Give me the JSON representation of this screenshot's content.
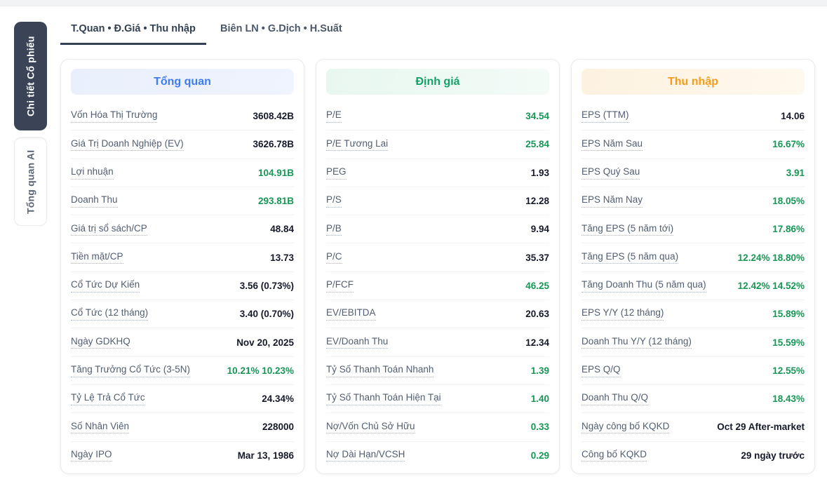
{
  "colors": {
    "side_tab_active_bg": "#3b4456",
    "tab_active": "#334155",
    "value_dark": "#15192a",
    "value_green": "#179656",
    "header_blue": "#3d7bf7",
    "header_green": "#12a266",
    "header_orange": "#f89b1b"
  },
  "side_tabs": [
    {
      "label": "Chi tiết Cổ phiếu",
      "active": true
    },
    {
      "label": "Tổng quan AI",
      "active": false
    }
  ],
  "top_tabs": [
    {
      "label": "T.Quan • Đ.Giá • Thu nhập",
      "active": true
    },
    {
      "label": "Biên LN • G.Dịch • H.Suất",
      "active": false
    }
  ],
  "cards": [
    {
      "slug": "overview",
      "theme": "blue",
      "title": "Tổng quan",
      "rows": [
        {
          "label": "Vốn Hóa Thị Trường",
          "value": "3608.42B",
          "color": "dark"
        },
        {
          "label": "Giá Trị Doanh Nghiệp (EV)",
          "value": "3626.78B",
          "color": "dark"
        },
        {
          "label": "Lợi nhuận",
          "value": "104.91B",
          "color": "green"
        },
        {
          "label": "Doanh Thu",
          "value": "293.81B",
          "color": "green"
        },
        {
          "label": "Giá trị sổ sách/CP",
          "value": "48.84",
          "color": "dark"
        },
        {
          "label": "Tiền mặt/CP",
          "value": "13.73",
          "color": "dark"
        },
        {
          "label": "Cổ Tức Dự Kiến",
          "value": "3.56 (0.73%)",
          "color": "dark"
        },
        {
          "label": "Cổ Tức (12 tháng)",
          "value": "3.40 (0.70%)",
          "color": "dark"
        },
        {
          "label": "Ngày GDKHQ",
          "value": "Nov 20, 2025",
          "color": "dark"
        },
        {
          "label": "Tăng Trưởng Cổ Tức (3-5N)",
          "value": "10.21% 10.23%",
          "color": "green"
        },
        {
          "label": "Tỷ Lệ Trả Cổ Tức",
          "value": "24.34%",
          "color": "dark"
        },
        {
          "label": "Số Nhân Viên",
          "value": "228000",
          "color": "dark"
        },
        {
          "label": "Ngày IPO",
          "value": "Mar 13, 1986",
          "color": "dark"
        }
      ]
    },
    {
      "slug": "valuation",
      "theme": "green",
      "title": "Định giá",
      "rows": [
        {
          "label": "P/E",
          "value": "34.54",
          "color": "green"
        },
        {
          "label": "P/E Tương Lai",
          "value": "25.84",
          "color": "green"
        },
        {
          "label": "PEG",
          "value": "1.93",
          "color": "dark"
        },
        {
          "label": "P/S",
          "value": "12.28",
          "color": "dark"
        },
        {
          "label": "P/B",
          "value": "9.94",
          "color": "dark"
        },
        {
          "label": "P/C",
          "value": "35.37",
          "color": "dark"
        },
        {
          "label": "P/FCF",
          "value": "46.25",
          "color": "green"
        },
        {
          "label": "EV/EBITDA",
          "value": "20.63",
          "color": "dark"
        },
        {
          "label": "EV/Doanh Thu",
          "value": "12.34",
          "color": "dark"
        },
        {
          "label": "Tỷ Số Thanh Toán Nhanh",
          "value": "1.39",
          "color": "green"
        },
        {
          "label": "Tỷ Số Thanh Toán Hiện Tại",
          "value": "1.40",
          "color": "green"
        },
        {
          "label": "Nợ/Vốn Chủ Sở Hữu",
          "value": "0.33",
          "color": "green"
        },
        {
          "label": "Nợ Dài Hạn/VCSH",
          "value": "0.29",
          "color": "green"
        }
      ]
    },
    {
      "slug": "income",
      "theme": "orange",
      "title": "Thu nhập",
      "rows": [
        {
          "label": "EPS (TTM)",
          "value": "14.06",
          "color": "dark"
        },
        {
          "label": "EPS Năm Sau",
          "value": "16.67%",
          "color": "green"
        },
        {
          "label": "EPS Quý Sau",
          "value": "3.91",
          "color": "green"
        },
        {
          "label": "EPS Năm Nay",
          "value": "18.05%",
          "color": "green"
        },
        {
          "label": "Tăng EPS (5 năm tới)",
          "value": "17.86%",
          "color": "green"
        },
        {
          "label": "Tăng EPS (5 năm qua)",
          "value": "12.24% 18.80%",
          "color": "green"
        },
        {
          "label": "Tăng Doanh Thu (5 năm qua)",
          "value": "12.42% 14.52%",
          "color": "green"
        },
        {
          "label": "EPS Y/Y (12 tháng)",
          "value": "15.89%",
          "color": "green"
        },
        {
          "label": "Doanh Thu Y/Y (12 tháng)",
          "value": "15.59%",
          "color": "green"
        },
        {
          "label": "EPS Q/Q",
          "value": "12.55%",
          "color": "green"
        },
        {
          "label": "Doanh Thu Q/Q",
          "value": "18.43%",
          "color": "green"
        },
        {
          "label": "Ngày công bố KQKD",
          "value": "Oct 29 After-market",
          "color": "dark"
        },
        {
          "label": "Công bố KQKD",
          "value": "29 ngày trước",
          "color": "dark"
        }
      ]
    }
  ]
}
